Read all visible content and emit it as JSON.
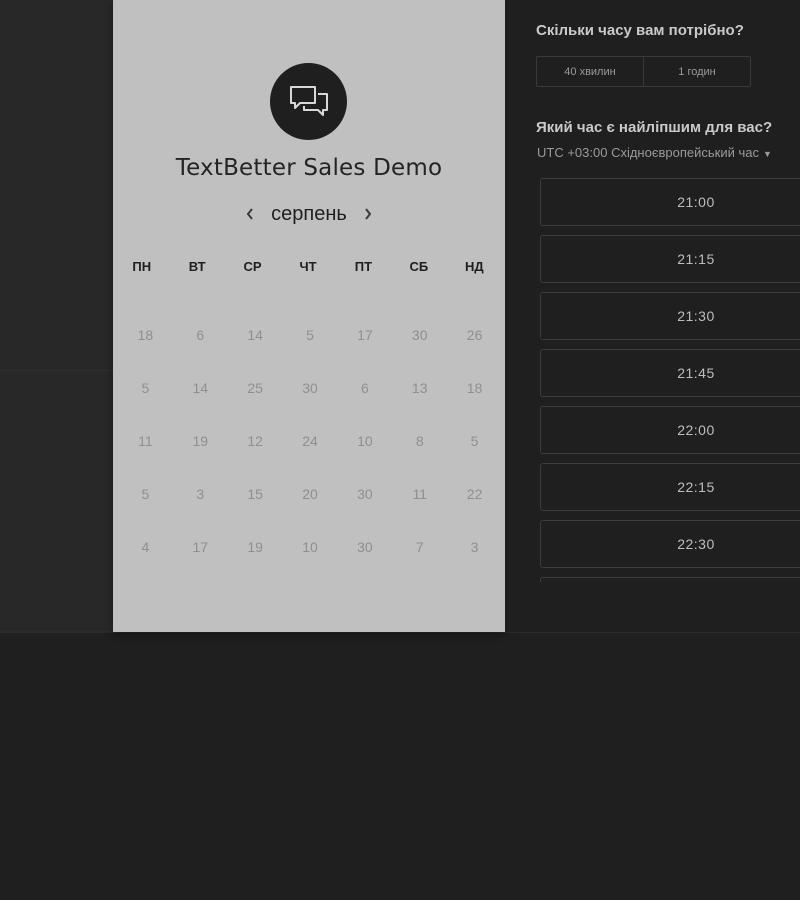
{
  "calendar": {
    "title": "TextBetter Sales Demo",
    "month": "серпень",
    "prev_icon": "chevron-left-icon",
    "next_icon": "chevron-right-icon",
    "logo_icon": "chat-bubbles-icon",
    "weekdays": [
      "ПН",
      "ВТ",
      "СР",
      "ЧТ",
      "ПТ",
      "СБ",
      "НД"
    ],
    "weeks": [
      [
        "18",
        "6",
        "14",
        "5",
        "17",
        "30",
        "26"
      ],
      [
        "5",
        "14",
        "25",
        "30",
        "6",
        "13",
        "18"
      ],
      [
        "11",
        "19",
        "12",
        "24",
        "10",
        "8",
        "5"
      ],
      [
        "5",
        "3",
        "15",
        "20",
        "30",
        "11",
        "22"
      ],
      [
        "4",
        "17",
        "19",
        "10",
        "30",
        "7",
        "3"
      ]
    ]
  },
  "scheduler": {
    "duration_question": "Скільки часу вам потрібно?",
    "durations": [
      "40 хвилин",
      "1 годин"
    ],
    "time_question": "Який час є найліпшим для вас?",
    "timezone": "UTC +03:00 Східноєвропейський час",
    "timezone_icon": "caret-down-icon",
    "slots": [
      "21:00",
      "21:15",
      "21:30",
      "21:45",
      "22:00",
      "22:15",
      "22:30",
      ""
    ]
  },
  "colors": {
    "calendar_bg": "#c0c0c0",
    "page_bg": "#1f1f1f",
    "slot_border": "#3c3c3c"
  }
}
